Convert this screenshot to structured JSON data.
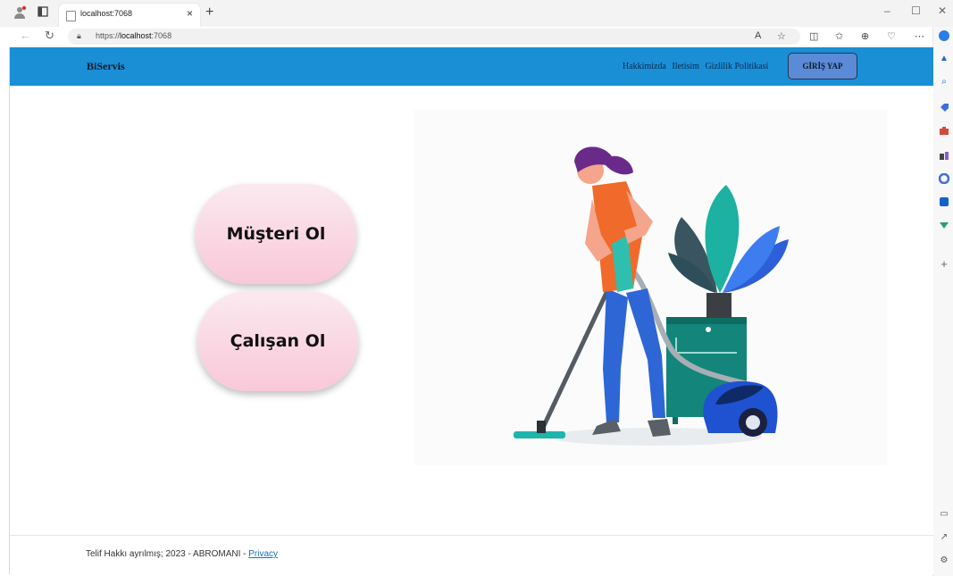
{
  "browser": {
    "tab_title": "localhost:7068",
    "tab_close": "×",
    "new_tab": "+",
    "url_scheme": "https://",
    "url_host": "localhost",
    "url_port": ":7068",
    "window_buttons": [
      "–",
      "☐",
      "✕"
    ]
  },
  "navbar": {
    "brand": "BiServis",
    "links": [
      "Hakkimizda",
      "Iletisim",
      "Gizlilik Politikasi"
    ],
    "login_label": "GİRİŞ YAP",
    "color": "#1a8fd6"
  },
  "main": {
    "customer_button": "Müşteri Ol",
    "worker_button": "Çalışan Ol"
  },
  "illustration": {
    "subject": "woman-vacuuming-illustration"
  },
  "footer": {
    "copyright": "Telif Hakkı ayrılmış; 2023 - ABROMANI - ",
    "privacy_link": "Privacy"
  }
}
